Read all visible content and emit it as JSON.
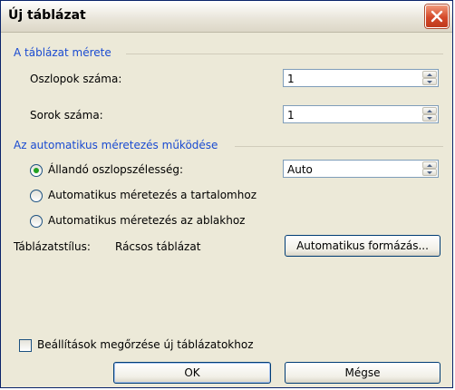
{
  "window": {
    "title": "Új táblázat"
  },
  "size_group": {
    "label": "A táblázat mérete",
    "columns_label": "Oszlopok száma:",
    "columns_value": "1",
    "rows_label": "Sorok száma:",
    "rows_value": "1"
  },
  "autofit_group": {
    "label": "Az automatikus méretezés működése",
    "fixed_width_label": "Állandó oszlopszélesség:",
    "fixed_width_value": "Auto",
    "autofit_contents_label": "Automatikus méretezés a tartalomhoz",
    "autofit_window_label": "Automatikus méretezés az ablakhoz",
    "selected": "fixed_width"
  },
  "table_style": {
    "label": "Táblázatstílus:",
    "value": "Rácsos táblázat",
    "autoformat_button": "Automatikus formázás..."
  },
  "remember_settings": {
    "label": "Beállítások megőrzése új táblázatokhoz",
    "checked": false
  },
  "buttons": {
    "ok": "OK",
    "cancel": "Mégse"
  },
  "icons": {
    "close": "close-icon"
  },
  "colors": {
    "accent": "#1a4bd1",
    "close_button": "#d4492a",
    "radio_dot": "#21a121"
  }
}
